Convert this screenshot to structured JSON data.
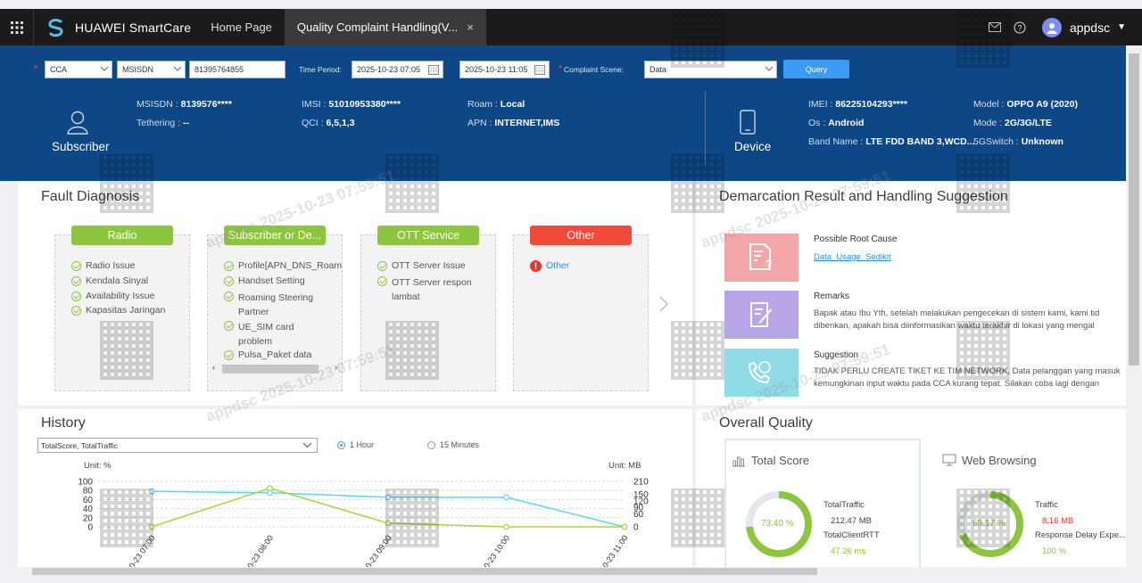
{
  "topbar": {
    "app_name": "HUAWEI SmartCare",
    "tab_home": "Home Page",
    "tab_active": "Quality Complaint Handling(V...",
    "tab_close": "×",
    "user": "appdsc"
  },
  "filters": {
    "system": "CCA",
    "id_type": "MSISDN",
    "msisdn": "81395764855",
    "time_label": "Time Period:",
    "time_from": "2025-10-23 07:05",
    "time_to": "2025-10-23 11:05",
    "scene_label": "Complaint Scene:",
    "scene_value": "Data",
    "query": "Query"
  },
  "subscriber": {
    "label": "Subscriber",
    "msisdn_key": "MSISDN",
    "msisdn": "8139576****",
    "tether_key": "Tethering",
    "tether": "--",
    "imsi_key": "IMSI",
    "imsi": "51010953380****",
    "qci_key": "QCI",
    "qci": "6,5,1,3",
    "roam_key": "Roam",
    "roam": "Local",
    "apn_key": "APN",
    "apn": "INTERNET,IMS"
  },
  "device": {
    "label": "Device",
    "imei_key": "IMEI",
    "imei": "86225104293****",
    "os_key": "Os",
    "os": "Android",
    "band_key": "Band Name",
    "band": "LTE FDD BAND 3,WCD...",
    "model_key": "Model",
    "model": "OPPO A9 (2020)",
    "mode_key": "Mode",
    "mode": "2G/3G/LTE",
    "g5_key": "5GSwitch",
    "g5": "Unknown"
  },
  "fault": {
    "title": "Fault Diagnosis",
    "cards": [
      {
        "head": "Radio",
        "items": [
          "Radio Issue",
          "Kendala Sinyal",
          "Availability Issue",
          "Kapasitas Jaringan"
        ]
      },
      {
        "head": "Subscriber or De...",
        "items": [
          "Profile[APN_DNS_Roam",
          "Handset Setting",
          "Roaming Steering Partner",
          "UE_SIM card problem",
          "Pulsa_Paket data"
        ]
      },
      {
        "head": "OTT Service",
        "items": [
          "OTT Server Issue",
          "OTT Server respon lambat"
        ]
      },
      {
        "head": "Other",
        "items": [
          "Other"
        ]
      }
    ],
    "colors": {
      "green": "#8cc63f",
      "red": "#f04a3b"
    }
  },
  "demarcation": {
    "title": "Demarcation Result and Handling Suggestion",
    "root_title": "Possible Root Cause",
    "root_link": "Data_Usage_Sedikit",
    "remarks_title": "Remarks",
    "remarks_1": "Bapak atau Ibu Yth, setelah melakukan pengecekan di sistem kami, kami tid",
    "remarks_2": "diberikan, apakah bisa diinformasikan waktu terakhir di lokasi yang mengal",
    "sugg_title": "Suggestion",
    "sugg_1": "TIDAK PERLU CREATE TIKET KE TIM NETWORK, Data pelanggan yang masuk",
    "sugg_2": "kemungkinan input waktu pada CCA kurang tepat. Silakan coba lagi dengan"
  },
  "history": {
    "title": "History",
    "select": "TotalScore, TotalTraffic",
    "radio_1h": "1 Hour",
    "radio_15m": "15 Minutes",
    "unit_left": "Unit: %",
    "unit_right": "Unit: MB"
  },
  "chart_data": {
    "type": "line",
    "x": [
      "10-23 07:00",
      "10-23 08:00",
      "10-23 09:00",
      "10-23 10:00",
      "10-23 11:00"
    ],
    "yticks_left": [
      "100",
      "80",
      "60",
      "40",
      "20",
      "0"
    ],
    "yticks_right": [
      "210",
      "150",
      "120",
      "90",
      "60",
      "0"
    ],
    "ylim_left": [
      0,
      100
    ],
    "ylim_right": [
      0,
      210
    ],
    "series": [
      {
        "axis": "left",
        "color": "#5ad8f0",
        "values": [
          78,
          75,
          65,
          65,
          0
        ]
      },
      {
        "axis": "left",
        "color": "#a6d63c",
        "values": [
          0,
          85,
          8,
          0,
          0
        ]
      }
    ]
  },
  "overall": {
    "title": "Overall Quality",
    "total_title": "Total Score",
    "total_pct": "73.40 %",
    "total_value": 73.4,
    "traffic_key": "TotalTraffic",
    "traffic_val": "212.47 MB",
    "rtt_key": "TotalClientRTT",
    "rtt_val": "47.26 ms",
    "web_title": "Web Browsing",
    "web_pct": "69.17 %",
    "web_value": 69.17,
    "web_traffic_key": "Traffic",
    "web_traffic_val": "8.16 MB",
    "web_delay_key": "Response Delay Expe...",
    "web_delay_val": "100 %"
  },
  "watermark": "appdsc 2025-10-23 07:59:51"
}
